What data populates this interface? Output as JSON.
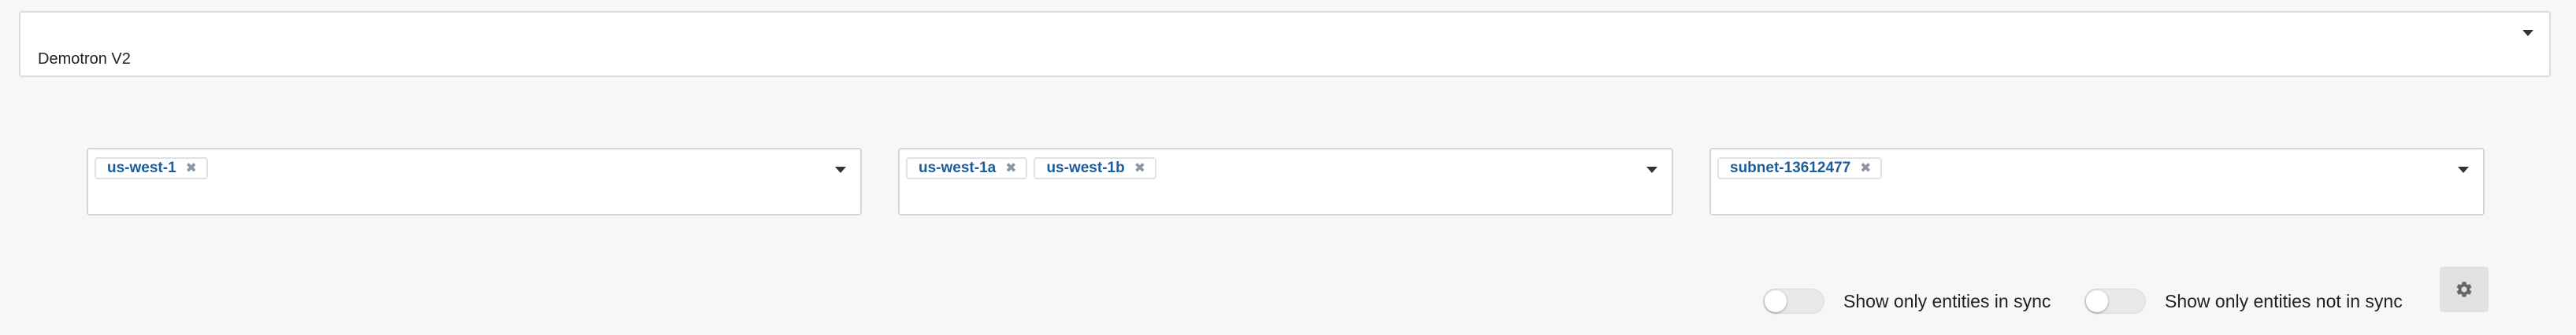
{
  "account_select": {
    "value": "Demotron V2"
  },
  "filters": {
    "regions": [
      "us-west-1"
    ],
    "zones": [
      "us-west-1a",
      "us-west-1b"
    ],
    "subnets": [
      "subnet-13612477"
    ]
  },
  "chip_remove_glyph": "✖",
  "toggles": {
    "in_sync_label": "Show only entities in sync",
    "in_sync_on": false,
    "not_in_sync_label": "Show only entities not in sync",
    "not_in_sync_on": false
  },
  "settings_button": {
    "icon": "gear-icon"
  },
  "colors": {
    "chip_text": "#1c5d9c",
    "background": "#f7f7f7"
  }
}
